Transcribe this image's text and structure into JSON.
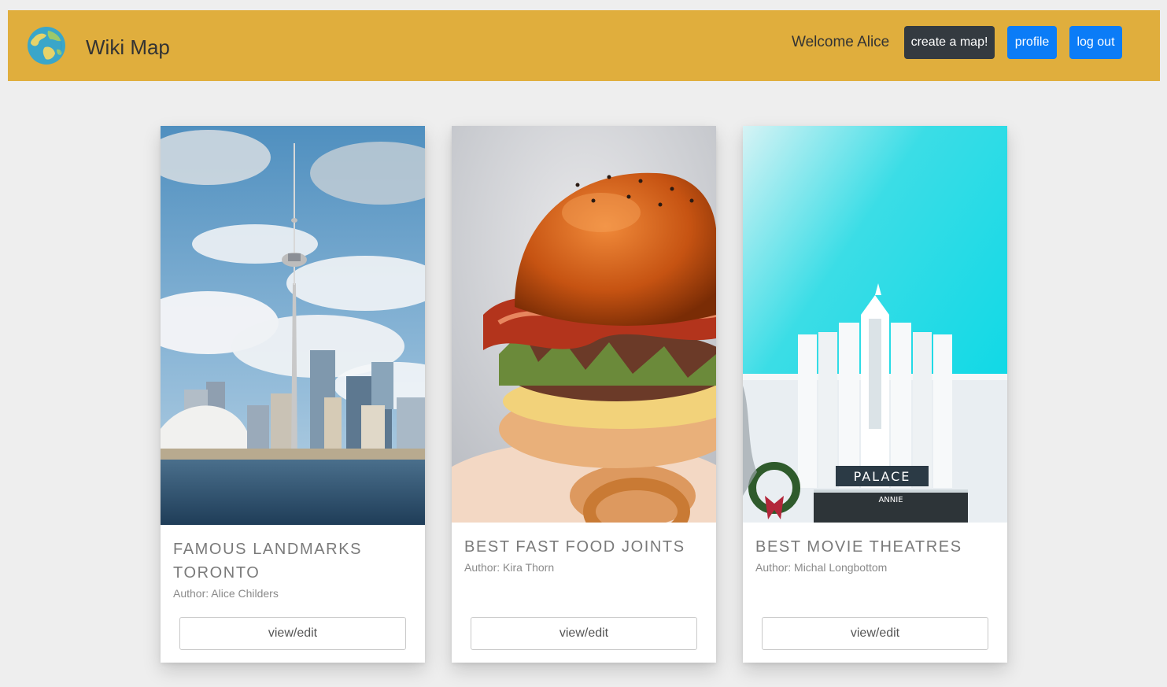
{
  "header": {
    "brand": "Wiki Map",
    "logo_icon": "globe-icon",
    "welcome": "Welcome Alice",
    "create_label": "create a map!",
    "profile_label": "profile",
    "logout_label": "log out",
    "colors": {
      "navbar": "#e0ae3d",
      "create_button": "#343a40",
      "primary_button": "#0b7cf7"
    }
  },
  "maps": [
    {
      "title": "FAMOUS LANDMARKS TORONTO",
      "author": "Author: Alice Childers",
      "button": "view/edit",
      "image": "toronto-skyline-photo"
    },
    {
      "title": "BEST FAST FOOD JOINTS",
      "author": "Author: Kira Thorn",
      "button": "view/edit",
      "image": "burger-photo"
    },
    {
      "title": "BEST MOVIE THEATRES",
      "author": "Author: Michal Longbottom",
      "button": "view/edit",
      "image": "palace-theatre-photo"
    }
  ]
}
